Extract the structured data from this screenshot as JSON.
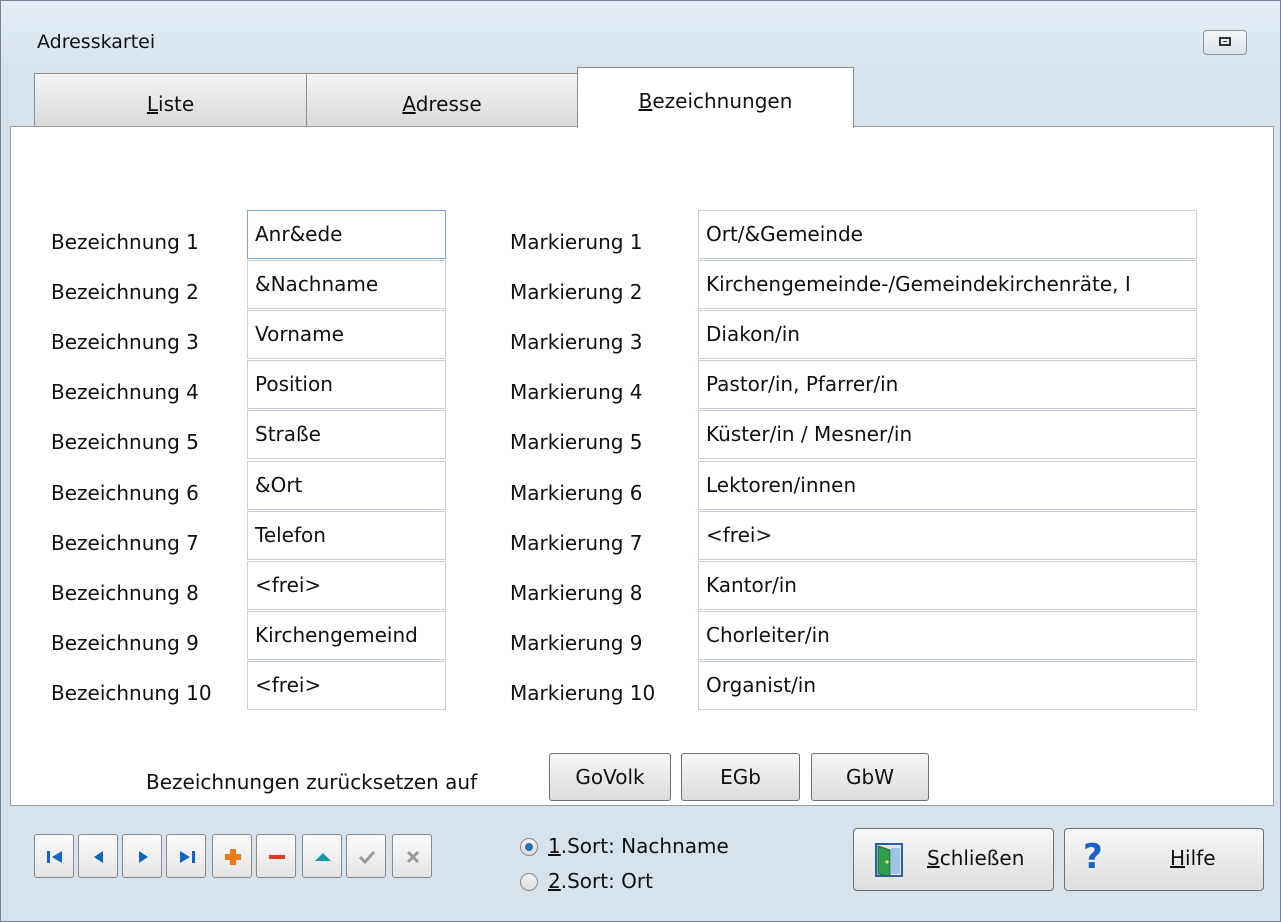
{
  "window": {
    "title": "Adresskartei"
  },
  "tabs": [
    {
      "label": "Liste",
      "u": "L",
      "rest": "iste"
    },
    {
      "label": "Adresse",
      "u": "A",
      "rest": "dresse"
    },
    {
      "label": "Bezeichnungen",
      "u": "B",
      "rest": "ezeichnungen"
    }
  ],
  "bezeichnungen": [
    {
      "label": "Bezeichnung 1",
      "value": "Anr&ede"
    },
    {
      "label": "Bezeichnung 2",
      "value": "&Nachname"
    },
    {
      "label": "Bezeichnung 3",
      "value": "Vorname"
    },
    {
      "label": "Bezeichnung 4",
      "value": "Position"
    },
    {
      "label": "Bezeichnung 5",
      "value": "Straße"
    },
    {
      "label": "Bezeichnung 6",
      "value": "&Ort"
    },
    {
      "label": "Bezeichnung 7",
      "value": "Telefon"
    },
    {
      "label": "Bezeichnung 8",
      "value": "<frei>"
    },
    {
      "label": "Bezeichnung 9",
      "value": "Kirchengemeind"
    },
    {
      "label": "Bezeichnung 10",
      "value": "<frei>"
    }
  ],
  "markierungen": [
    {
      "label": "Markierung 1",
      "value": "Ort/&Gemeinde"
    },
    {
      "label": "Markierung 2",
      "value": "Kirchengemeinde-/Gemeindekirchenräte, I"
    },
    {
      "label": "Markierung 3",
      "value": "Diakon/in"
    },
    {
      "label": "Markierung 4",
      "value": "Pastor/in, Pfarrer/in"
    },
    {
      "label": "Markierung 5",
      "value": "Küster/in / Mesner/in"
    },
    {
      "label": "Markierung 6",
      "value": "Lektoren/innen"
    },
    {
      "label": "Markierung 7",
      "value": "<frei>"
    },
    {
      "label": "Markierung 8",
      "value": "Kantor/in"
    },
    {
      "label": "Markierung 9",
      "value": "Chorleiter/in"
    },
    {
      "label": "Markierung 10",
      "value": "Organist/in"
    }
  ],
  "reset": {
    "label": "Bezeichnungen zurücksetzen auf",
    "buttons": [
      "GoVolk",
      "EGb",
      "GbW"
    ]
  },
  "navigation": {
    "icons": [
      "first-record-icon",
      "previous-record-icon",
      "next-record-icon",
      "last-record-icon",
      "add-record-icon",
      "delete-record-icon",
      "edit-record-icon",
      "confirm-icon",
      "cancel-icon"
    ]
  },
  "sort": {
    "options": [
      {
        "u": "1",
        "rest": ".Sort: Nachname",
        "selected": true
      },
      {
        "u": "2",
        "rest": ".Sort: Ort",
        "selected": false
      }
    ]
  },
  "buttons": {
    "close": {
      "u": "S",
      "rest": "chließen"
    },
    "help": {
      "u": "H",
      "rest": "ilfe"
    }
  },
  "colors": {
    "nav_blue": "#1565c0",
    "add_orange": "#f07a14",
    "delete_red": "#e23b22",
    "edit_teal": "#179aa6",
    "disabled_gray": "#9a9a9a",
    "help_blue": "#1c62c4"
  }
}
